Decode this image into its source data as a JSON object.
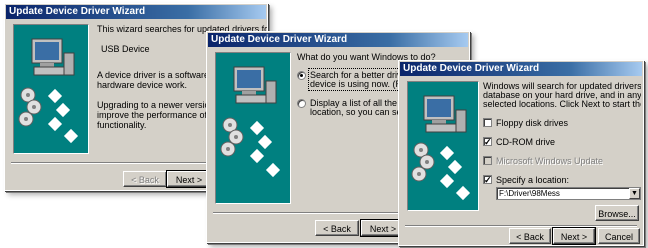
{
  "colors": {
    "dialog_bg": "#d4d0c8",
    "title_start": "#0a246a",
    "title_end": "#a6caf0",
    "art_bg": "#008080"
  },
  "window1": {
    "title": "Update Device Driver Wizard",
    "line1": "This wizard searches for updated drivers for:",
    "device": "USB Device",
    "desc1": "A device driver is a software program that",
    "desc2": "hardware device work.",
    "upg1": "Upgrading to a newer version of a device",
    "upg2": "improve the performance of your hardware",
    "upg3": "functionality.",
    "back": "< Back",
    "next": "Next >"
  },
  "window2": {
    "title": "Update Device Driver Wizard",
    "question": "What do you want Windows to do?",
    "opt1_l1": "Search for a better driver than the",
    "opt1_l2": "device is using now. (Recommen",
    "opt2_l1": "Display a list of all the drivers in a",
    "opt2_l2": "location, so you can select the d",
    "back": "< Back",
    "next": "Next >"
  },
  "window3": {
    "title": "Update Device Driver Wizard",
    "intro1": "Windows will search for updated drivers in its driver",
    "intro2": "database on your hard drive, and in any of the following",
    "intro3": "selected locations. Click Next to start the search.",
    "floppy": "Floppy disk drives",
    "cdrom": "CD-ROM drive",
    "msupdate": "Microsoft Windows Update",
    "specify": "Specify a location:",
    "location_value": "F:\\Driver\\98Mess",
    "browse": "Browse...",
    "back": "< Back",
    "next": "Next >",
    "cancel": "Cancel"
  }
}
